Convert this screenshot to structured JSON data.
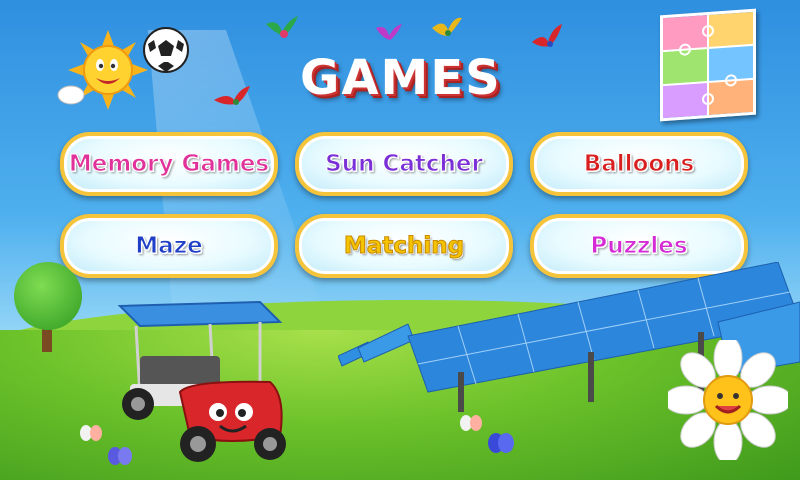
{
  "title": "GAMES",
  "buttons": [
    {
      "label": "Memory Games",
      "color": "#e0329a"
    },
    {
      "label": "Sun Catcher",
      "color": "#7b2fd6"
    },
    {
      "label": "Balloons",
      "color": "#d81e1e"
    },
    {
      "label": "Maze",
      "color": "#1f3fc8"
    },
    {
      "label": "Matching",
      "color": "#f5c400"
    },
    {
      "label": "Puzzles",
      "color": "#d42bd6"
    }
  ],
  "icons": {
    "sun": "smiling-sun",
    "ball": "soccer-ball",
    "puzzle": "jigsaw-puzzle",
    "birds": "flying-birds",
    "cart": "smiling-golf-cart",
    "panels": "solar-panels",
    "daisy": "smiling-daisy",
    "tree": "tree",
    "butterflies": "butterflies"
  }
}
